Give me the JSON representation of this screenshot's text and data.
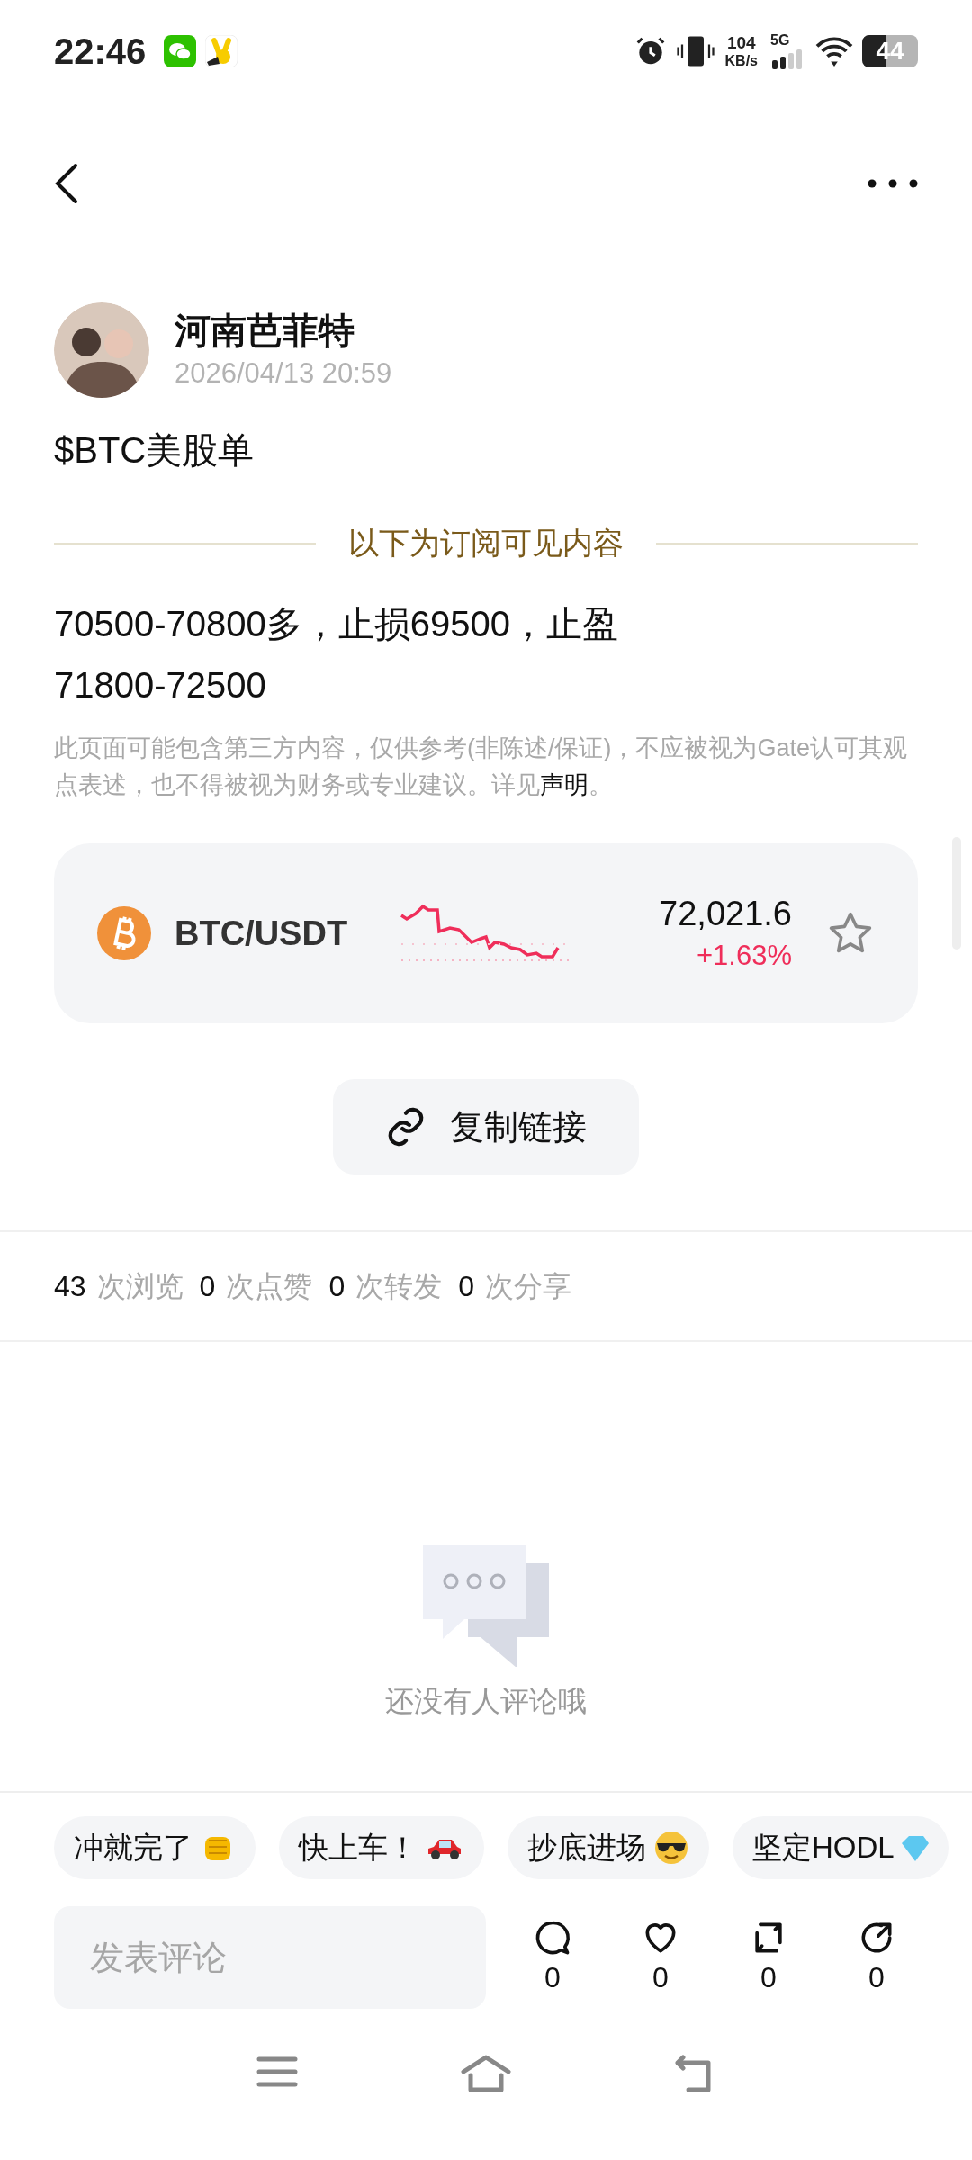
{
  "status_bar": {
    "time": "22:46",
    "net_speed_value": "104",
    "net_speed_unit": "KB/s",
    "network": "5G",
    "battery": "44"
  },
  "post": {
    "author": "河南芭菲特",
    "time": "2026/04/13 20:59",
    "title": "$BTC美股单",
    "divider_label": "以下为订阅可见内容",
    "lines": [
      "70500-70800多，止损69500，止盈",
      "71800-72500"
    ],
    "disclaimer": "此页面可能包含第三方内容，仅供参考(非陈述/保证)，不应被视为Gate认可其观点表述，也不得被视为财务或专业建议。详见",
    "disclaimer_link": "声明",
    "disclaimer_end": "。"
  },
  "ticker": {
    "pair": "BTC/USDT",
    "price": "72,021.6",
    "change": "+1.63%",
    "favorited": false
  },
  "copy_link": "复制链接",
  "stats": [
    {
      "count": "43",
      "label": "次浏览"
    },
    {
      "count": "0",
      "label": "次点赞"
    },
    {
      "count": "0",
      "label": "次转发"
    },
    {
      "count": "0",
      "label": "次分享"
    }
  ],
  "comments_empty": "还没有人评论哦",
  "quick_replies": [
    {
      "text": "冲就完了",
      "kind": "fist"
    },
    {
      "text": "快上车！",
      "kind": "car"
    },
    {
      "text": "抄底进场",
      "kind": "sunglasses"
    },
    {
      "text": "坚定HODL",
      "kind": "gem"
    }
  ],
  "comment_input": {
    "placeholder": "发表评论"
  },
  "actions": [
    {
      "kind": "comment",
      "count": "0"
    },
    {
      "kind": "like",
      "count": "0"
    },
    {
      "kind": "repost",
      "count": "0"
    },
    {
      "kind": "share",
      "count": "0"
    }
  ]
}
